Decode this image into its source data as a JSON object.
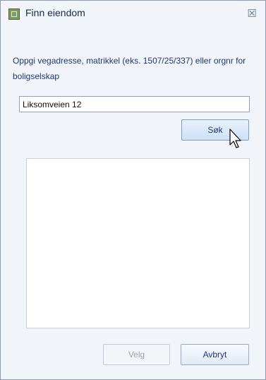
{
  "window": {
    "title": "Finn eiendom",
    "app_icon": "property-icon",
    "close_icon": "close-icon",
    "close_glyph": "☒"
  },
  "form": {
    "instruction": "Oppgi vegadresse, matrikkel  (eks. 1507/25/337) eller orgnr for boligselskap",
    "search_value": "Liksomveien 12",
    "search_button_label": "Søk"
  },
  "results": {
    "items": []
  },
  "footer": {
    "select_label": "Velg",
    "select_enabled": false,
    "cancel_label": "Avbryt"
  },
  "colors": {
    "window_bg": "#f1f4f9",
    "text": "#1e3a73",
    "input_border": "#8ba2c3"
  }
}
